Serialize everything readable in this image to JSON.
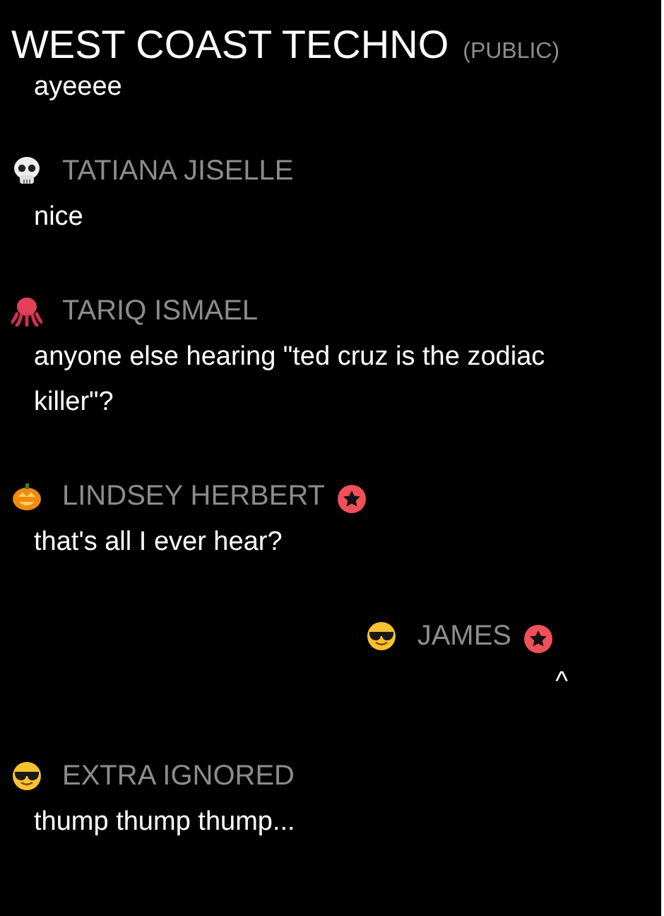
{
  "header": {
    "title": "WEST COAST TECHNO",
    "visibility": "(PUBLIC)"
  },
  "messages": [
    {
      "body": [
        "ayeeee"
      ]
    },
    {
      "name": "TATIANA JISELLE",
      "kind": "skull",
      "starred": false,
      "self": false,
      "body": [
        "nice"
      ]
    },
    {
      "name": "TARIQ ISMAEL",
      "kind": "octopus",
      "starred": false,
      "self": false,
      "body": [
        "anyone else hearing \"ted cruz is the zodiac killer\"?"
      ]
    },
    {
      "name": "LINDSEY HERBERT",
      "kind": "pumpkin",
      "starred": true,
      "self": false,
      "body": [
        "that's all I ever hear?"
      ]
    },
    {
      "name": "JAMES",
      "kind": "sunglasses",
      "starred": true,
      "self": true,
      "body": [
        "^"
      ]
    },
    {
      "name": "EXTRA IGNORED",
      "kind": "sunglasses",
      "starred": false,
      "self": false,
      "body": [
        "thump thump thump..."
      ]
    }
  ]
}
